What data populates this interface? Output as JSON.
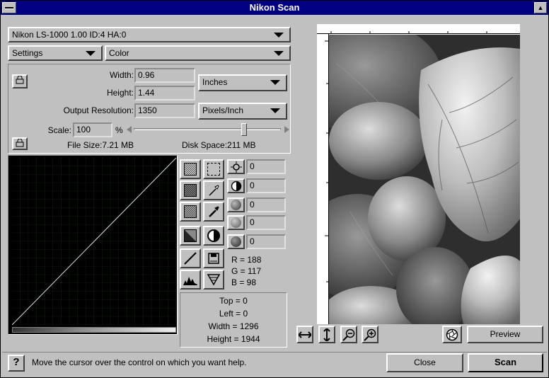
{
  "window": {
    "title": "Nikon Scan"
  },
  "scanner": {
    "device": "Nikon  LS-1000       1.00 ID:4 HA:0"
  },
  "settings": {
    "menu": "Settings",
    "mode": "Color"
  },
  "size": {
    "width_label": "Width:",
    "width_value": "0.96",
    "height_label": "Height:",
    "height_value": "1.44",
    "unit": "Inches",
    "res_label": "Output Resolution:",
    "res_value": "1350",
    "res_unit": "Pixels/Inch",
    "scale_label": "Scale:",
    "scale_value": "100",
    "scale_pct": "%",
    "file_size": "File Size:7.21 MB",
    "disk_space": "Disk Space:211 MB"
  },
  "adjust": {
    "values": [
      "0",
      "0",
      "0",
      "0",
      "0"
    ]
  },
  "readout": {
    "r": "R = 188",
    "g": "G = 117",
    "b": "B =  98"
  },
  "crop": {
    "top": "Top = 0",
    "left": "Left = 0",
    "width": "Width = 1296",
    "height": "Height = 1944"
  },
  "preview": {
    "button": "Preview"
  },
  "status": {
    "help_icon": "?",
    "text": "Move the cursor over the control on which you want help."
  },
  "buttons": {
    "close": "Close",
    "scan": "Scan"
  }
}
